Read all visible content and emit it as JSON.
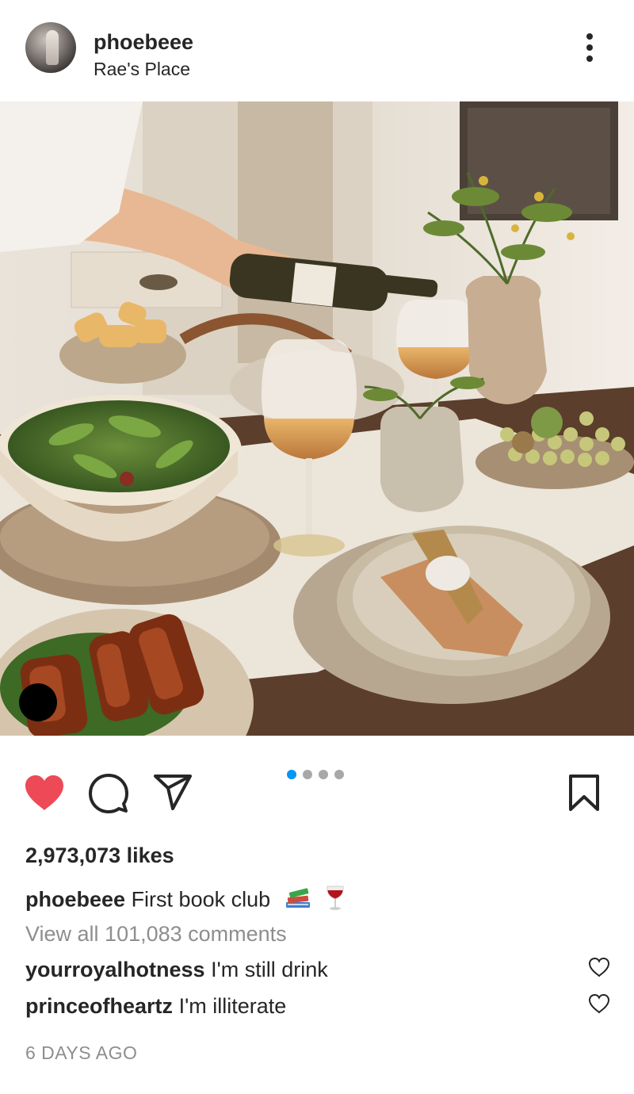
{
  "post": {
    "username": "phoebeee",
    "location": "Rae's Place",
    "likes_text": "2,973,073 likes",
    "caption": {
      "username": "phoebeee",
      "text": "First book club"
    },
    "view_all_comments": "View all 101,083 comments",
    "comments": [
      {
        "username": "yourroyalhotness",
        "text": "I'm still drink"
      },
      {
        "username": "princeofheartz",
        "text": "I'm illiterate"
      }
    ],
    "timestamp": "6 DAYS AGO",
    "carousel": {
      "count": 4,
      "active_index": 0
    }
  },
  "colors": {
    "like_red": "#ed4956",
    "carousel_active": "#0095f6",
    "carousel_inactive": "#a8a8a8",
    "text_primary": "#262626",
    "text_secondary": "#8e8e8e"
  },
  "icons": {
    "more": "more-options-icon",
    "like": "heart-filled-icon",
    "comment": "comment-bubble-icon",
    "share": "paper-plane-icon",
    "save": "bookmark-icon",
    "comment_like": "heart-outline-icon",
    "caption_emojis": [
      "books-emoji",
      "wine-glass-emoji"
    ]
  }
}
